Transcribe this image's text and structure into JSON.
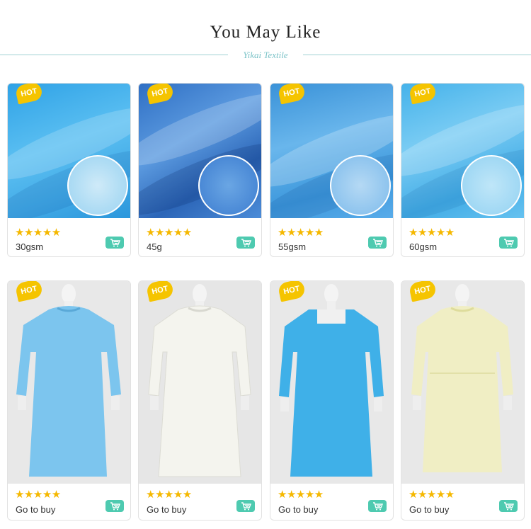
{
  "header": {
    "title": "You May Like",
    "brand": "Yikai Textile"
  },
  "colors": {
    "rule": "#9fd1d4",
    "star": "#f5b800",
    "hot_badge": "#f5c400",
    "cart_button": "#4ecab0"
  },
  "fabrics": [
    {
      "badge": "HOT",
      "stars": "★★★★★",
      "rating": 5,
      "label": "30gsm",
      "color": "#38a9e8",
      "cart_icon": "cart-icon"
    },
    {
      "badge": "HOT",
      "stars": "★★★★★",
      "rating": 5,
      "label": "45g",
      "color": "#3b7fcf",
      "cart_icon": "cart-icon"
    },
    {
      "badge": "HOT",
      "stars": "★★★★★",
      "rating": 5,
      "label": "55gsm",
      "color": "#3d9ee0",
      "cart_icon": "cart-icon"
    },
    {
      "badge": "HOT",
      "stars": "★★★★★",
      "rating": 5,
      "label": "60gsm",
      "color": "#4cb9ea",
      "cart_icon": "cart-icon"
    }
  ],
  "gowns": [
    {
      "badge": "HOT",
      "stars": "★★★★★",
      "rating": 5,
      "label": "Go to buy",
      "color": "#7cc5ee",
      "cart_icon": "cart-icon"
    },
    {
      "badge": "HOT",
      "stars": "★★★★★",
      "rating": 5,
      "label": "Go to buy",
      "color": "#f4f4ee",
      "cart_icon": "cart-icon"
    },
    {
      "badge": "HOT",
      "stars": "★★★★★",
      "rating": 5,
      "label": "Go to buy",
      "color": "#3fb0e8",
      "cart_icon": "cart-icon"
    },
    {
      "badge": "HOT",
      "stars": "★★★★★",
      "rating": 5,
      "label": "Go to buy",
      "color": "#f0eec4",
      "cart_icon": "cart-icon"
    }
  ]
}
